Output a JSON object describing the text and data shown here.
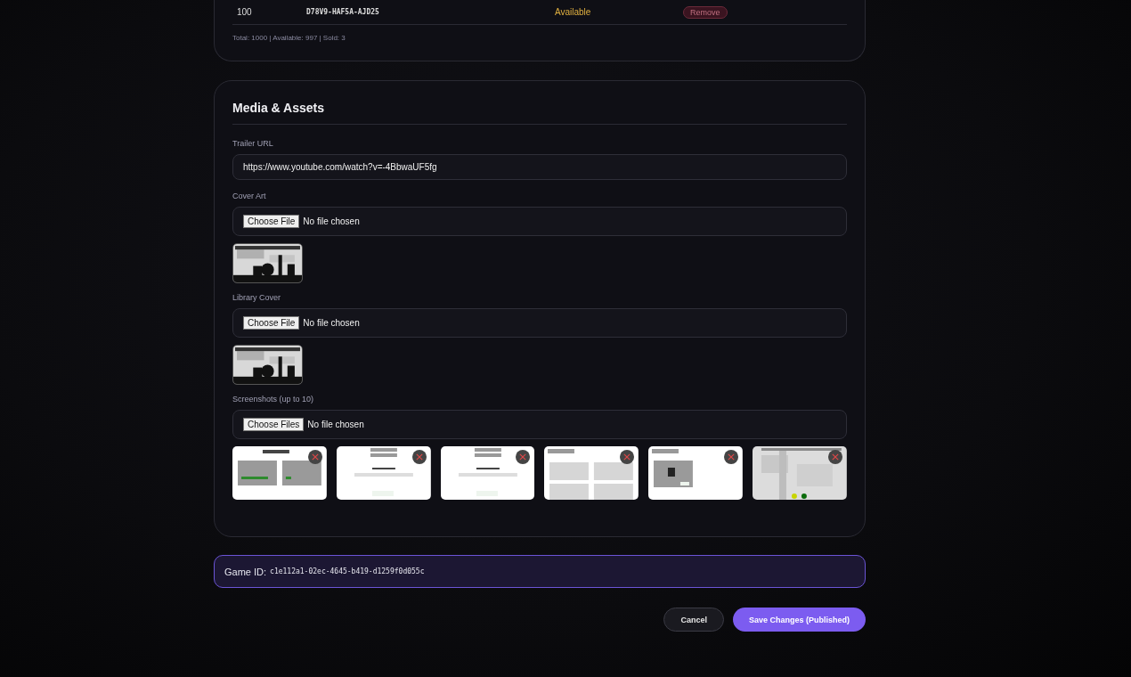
{
  "keys_card": {
    "rows": [
      {
        "number": "100",
        "key": "D78V9-HAF5A-AJD25",
        "status": "Available",
        "action": "Remove"
      }
    ],
    "summary": "Total: 1000 | Available: 997 | Sold: 3"
  },
  "media": {
    "title": "Media & Assets",
    "fields": [
      {
        "kind": "text",
        "label": "Trailer URL",
        "value": "https://www.youtube.com/watch?v=-4BbwaUF5fg"
      },
      {
        "kind": "file",
        "label": "Cover Art",
        "button": "Choose File",
        "status": "No file chosen",
        "previews": [
          {
            "kind": "cover"
          }
        ]
      },
      {
        "kind": "file",
        "label": "Library Cover",
        "button": "Choose File",
        "status": "No file chosen",
        "previews": [
          {
            "kind": "cover"
          }
        ]
      },
      {
        "kind": "file",
        "label": "Screenshots (up to 10)",
        "button": "Choose Files",
        "status": "No file chosen",
        "previews": [
          {
            "kind": "screenshot",
            "removable": true
          },
          {
            "kind": "screenshot",
            "removable": true
          },
          {
            "kind": "screenshot",
            "removable": true
          },
          {
            "kind": "screenshot",
            "removable": true
          },
          {
            "kind": "screenshot",
            "removable": true
          },
          {
            "kind": "screenshot",
            "removable": true
          }
        ]
      }
    ]
  },
  "game_id": {
    "label": "Game ID:",
    "value": "c1e112a1-02ec-4645-b419-d1259f0d055c"
  },
  "buttons": [
    {
      "kind": "secondary",
      "label": "Cancel"
    },
    {
      "kind": "primary",
      "label": "Save Changes (Published)"
    }
  ]
}
